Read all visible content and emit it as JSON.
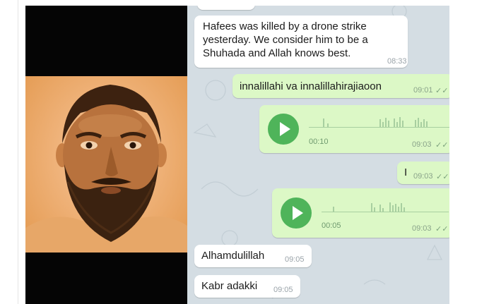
{
  "photo": {
    "alt_icon": "bearded-man-portrait"
  },
  "chat": {
    "messages": [
      {
        "type": "text",
        "dir": "in",
        "text_lines": [
          "Hafees was killed by a drone strike",
          "yesterday. We consider him to be a",
          "Shuhada and Allah knows best."
        ],
        "time": "08:33"
      },
      {
        "type": "text",
        "dir": "out",
        "text": "innalillahi va innalillahirajiaoon",
        "time": "09:01",
        "status_icon": "double-check-icon"
      },
      {
        "type": "voice",
        "dir": "out",
        "duration": "00:10",
        "time": "09:03",
        "status_icon": "double-check-icon"
      },
      {
        "type": "text",
        "dir": "out",
        "text": "I",
        "time": "09:03",
        "status_icon": "double-check-icon"
      },
      {
        "type": "voice",
        "dir": "out",
        "duration": "00:05",
        "time": "09:03",
        "status_icon": "double-check-icon"
      },
      {
        "type": "text",
        "dir": "in",
        "text": "Alhamdulillah",
        "time": "09:05"
      },
      {
        "type": "text",
        "dir": "in",
        "text": "Kabr adakki",
        "time": "09:05"
      }
    ],
    "colors": {
      "incoming": "#ffffff",
      "outgoing": "#dcf8c6",
      "play_button": "#4fb45a",
      "background": "#d4dde3"
    },
    "check_glyph": "✓✓"
  }
}
